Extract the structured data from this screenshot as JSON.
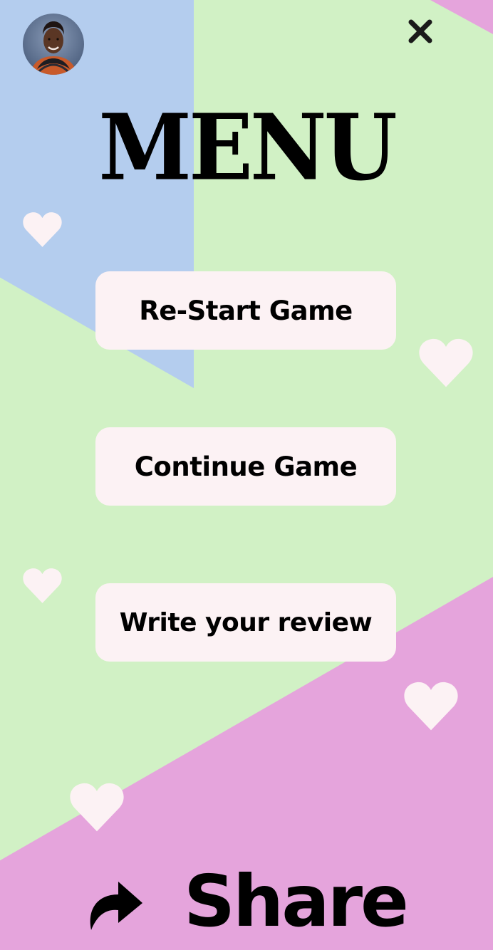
{
  "menu": {
    "title": "MENU",
    "restart_label": "Re-Start Game",
    "continue_label": "Continue Game",
    "review_label": "Write your review"
  },
  "share": {
    "label": "Share"
  },
  "icons": {
    "close": "close-icon",
    "share": "share-arrow-icon",
    "heart": "heart-icon",
    "avatar": "avatar"
  },
  "colors": {
    "background_green": "#d1f1c5",
    "background_blue": "#b4cdee",
    "background_pink": "#e5a4dc",
    "button_fill": "#fcf2f4",
    "heart_fill": "#fcf2f4",
    "text": "#000000"
  }
}
